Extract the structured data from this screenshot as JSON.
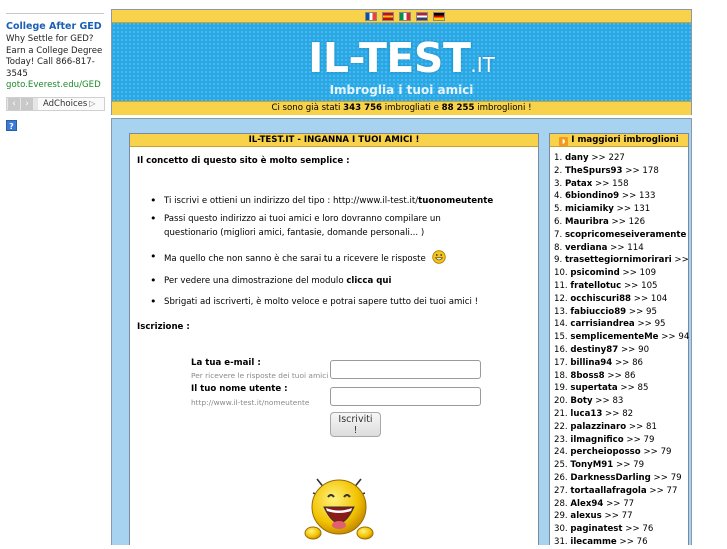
{
  "ad": {
    "title": "College After GED",
    "text_lines": [
      "Why Settle for GED?",
      "Earn a College Degree",
      "Today! Call 866-817-",
      "3545"
    ],
    "link": "goto.Everest.edu/GED",
    "adchoices_label": "AdChoices",
    "help_label": "?"
  },
  "header": {
    "flags": [
      {
        "name": "flag-france",
        "colors": [
          "#0055a4",
          "#ffffff",
          "#ef4135"
        ]
      },
      {
        "name": "flag-spain",
        "colors": [
          "#c60b1e",
          "#ffc400",
          "#c60b1e"
        ]
      },
      {
        "name": "flag-italy",
        "colors": [
          "#009246",
          "#ffffff",
          "#ce2b37"
        ]
      },
      {
        "name": "flag-uk-us",
        "colors": [
          "#b22234",
          "#ffffff",
          "#3c3b6e"
        ]
      },
      {
        "name": "flag-germany",
        "colors": [
          "#000000",
          "#dd0000",
          "#ffce00"
        ]
      }
    ],
    "site_name": "IL-TEST",
    "site_tld": ".IT",
    "subtitle": "Imbroglia i tuoi amici",
    "stats": {
      "prefix": "Ci sono già stati ",
      "imbrogliati_count": "343 756",
      "middle": " imbrogliati e ",
      "imbroglioni_count": "88 255",
      "suffix": " imbroglioni !"
    }
  },
  "main": {
    "heading": "IL-TEST.IT - INGANNA I TUOI AMICI !",
    "intro": "Il concetto di questo sito è molto semplice :",
    "bullets": [
      {
        "text": "Ti iscrivi e ottieni un indirizzo del tipo : http://www.il-test.it/",
        "bold": "tuonomeutente"
      },
      {
        "text": "Passi questo indirizzo ai tuoi amici e loro dovranno compilare un questionario (migliori amici, fantasie, domande personali... )",
        "bold": ""
      },
      {
        "text": "Ma quello che non sanno è che sarai tu a ricevere le risposte",
        "bold": ""
      },
      {
        "text": "Per vedere una dimostrazione del modulo ",
        "bold": "clicca qui"
      },
      {
        "text": "Sbrigati ad iscriverti, è molto veloce e potrai sapere tutto dei tuoi amici !",
        "bold": ""
      }
    ],
    "signup_label": "Iscrizione :",
    "email_label": "La tua e-mail :",
    "email_hint": "Per ricevere le risposte dei tuoi amici",
    "email_value": "",
    "username_label": "Il tuo nome utente :",
    "username_hint": "http://www.il-test.it/nomeutente",
    "username_value": "",
    "submit_label": "Iscriviti !"
  },
  "top": {
    "heading": "I maggiori imbroglioni",
    "entries": [
      {
        "rank": "1.",
        "name": "dany",
        "score": "227"
      },
      {
        "rank": "2.",
        "name": "TheSpurs93",
        "score": "178"
      },
      {
        "rank": "3.",
        "name": "Patax",
        "score": "158"
      },
      {
        "rank": "4.",
        "name": "6biondino9",
        "score": "133"
      },
      {
        "rank": "5.",
        "name": "miciamiky",
        "score": "131"
      },
      {
        "rank": "6.",
        "name": "Mauribra",
        "score": "126"
      },
      {
        "rank": "7.",
        "name": "scopricomeseiveramente",
        "score": "124"
      },
      {
        "rank": "8.",
        "name": "verdiana",
        "score": "114"
      },
      {
        "rank": "9.",
        "name": "trasettegiornimorirari",
        "score": "110"
      },
      {
        "rank": "10.",
        "name": "psicomind",
        "score": "109"
      },
      {
        "rank": "11.",
        "name": "fratellotuc",
        "score": "105"
      },
      {
        "rank": "12.",
        "name": "occhiscuri88",
        "score": "104"
      },
      {
        "rank": "13.",
        "name": "fabiuccio89",
        "score": "95"
      },
      {
        "rank": "14.",
        "name": "carrisiandrea",
        "score": "95"
      },
      {
        "rank": "15.",
        "name": "semplicementeMe",
        "score": "94"
      },
      {
        "rank": "16.",
        "name": "destiny87",
        "score": "90"
      },
      {
        "rank": "17.",
        "name": "billina94",
        "score": "86"
      },
      {
        "rank": "18.",
        "name": "8boss8",
        "score": "86"
      },
      {
        "rank": "19.",
        "name": "supertata",
        "score": "85"
      },
      {
        "rank": "20.",
        "name": "Boty",
        "score": "83"
      },
      {
        "rank": "21.",
        "name": "luca13",
        "score": "82"
      },
      {
        "rank": "22.",
        "name": "palazzinaro",
        "score": "81"
      },
      {
        "rank": "23.",
        "name": "ilmagnifico",
        "score": "79"
      },
      {
        "rank": "24.",
        "name": "percheioposso",
        "score": "79"
      },
      {
        "rank": "25.",
        "name": "TonyM91",
        "score": "79"
      },
      {
        "rank": "26.",
        "name": "DarknessDarling",
        "score": "79"
      },
      {
        "rank": "27.",
        "name": "tortaallafragola",
        "score": "77"
      },
      {
        "rank": "28.",
        "name": "Alex94",
        "score": "77"
      },
      {
        "rank": "29.",
        "name": "alexus",
        "score": "77"
      },
      {
        "rank": "30.",
        "name": "paginatest",
        "score": "76"
      },
      {
        "rank": "31.",
        "name": "ilecamme",
        "score": "76"
      }
    ]
  },
  "colors": {
    "header_blue": "#28a9e6",
    "bar_yellow": "#f7d24a",
    "panel_bg": "#a7d3f1",
    "ad_title": "#1a5fb4",
    "ad_link": "#1c8a2a"
  }
}
